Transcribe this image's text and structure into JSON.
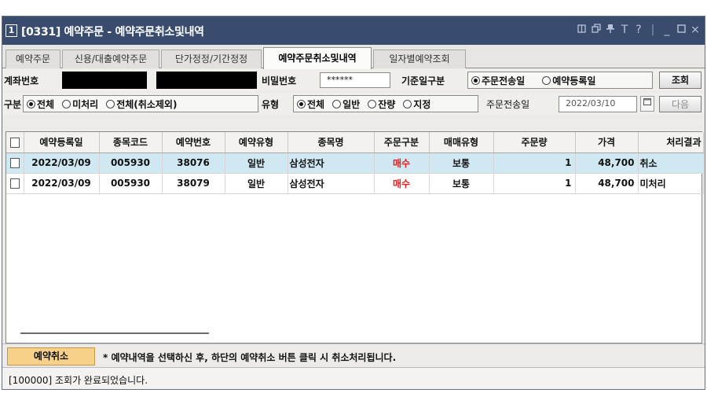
{
  "window": {
    "number": "1",
    "title": "[0331] 예약주문 - 예약주문취소및내역",
    "icons": [
      "window-restore-icon",
      "window-copy-icon",
      "pin-icon",
      "font-size-icon",
      "help-icon",
      "minimize-icon",
      "maximize-icon",
      "close-icon"
    ],
    "icon_glyphs": {
      "t": "T",
      "help": "?",
      "minimize": "_",
      "close": "×"
    }
  },
  "tabs": [
    {
      "label": "예약주문",
      "active": false
    },
    {
      "label": "신용/대출예약주문",
      "active": false
    },
    {
      "label": "단가정정/기간정정",
      "active": false
    },
    {
      "label": "예약주문취소및내역",
      "active": true
    },
    {
      "label": "일자별예약조회",
      "active": false
    }
  ],
  "form": {
    "account_label": "계좌번호",
    "password_label": "비밀번호",
    "password_value": "******",
    "date_type_label": "기준일구분",
    "date_type_options": [
      "주문전송일",
      "예약등록일"
    ],
    "date_type_selected": "주문전송일",
    "search_button": "조회",
    "division_label": "구분",
    "division_options": [
      "전체",
      "미처리",
      "전체(취소제외)"
    ],
    "division_selected": "전체",
    "type_label": "유형",
    "type_options": [
      "전체",
      "일반",
      "잔량",
      "지정"
    ],
    "type_selected": "전체",
    "send_date_label": "주문전송일",
    "send_date_value": "2022/03/10",
    "next_button": "다음"
  },
  "table": {
    "headers": [
      "",
      "예약등록일",
      "종목코드",
      "예약번호",
      "예약유형",
      "종목명",
      "주문구분",
      "매매유형",
      "주문량",
      "가격",
      "처리결과"
    ],
    "rows": [
      {
        "selected": true,
        "date": "2022/03/09",
        "code": "005930",
        "res_no": "38076",
        "res_type": "일반",
        "name": "삼성전자",
        "order_side": "매수",
        "trade_type": "보통",
        "qty": "1",
        "price": "48,700",
        "result": "취소"
      },
      {
        "selected": false,
        "date": "2022/03/09",
        "code": "005930",
        "res_no": "38079",
        "res_type": "일반",
        "name": "삼성전자",
        "order_side": "매수",
        "trade_type": "보통",
        "qty": "1",
        "price": "48,700",
        "result": "미처리"
      }
    ]
  },
  "bottom": {
    "cancel_button": "예약취소",
    "notice": "* 예약내역을 선택하신 후, 하단의 예약취소 버튼 클릭 시 취소처리됩니다."
  },
  "status": {
    "message": "[100000] 조회가 완료되었습니다."
  },
  "colors": {
    "titlebar": "#3a4c6e",
    "selected_row": "#cfe8f1",
    "buy_text": "#e02020",
    "cancel_button": "#f7d08a"
  }
}
